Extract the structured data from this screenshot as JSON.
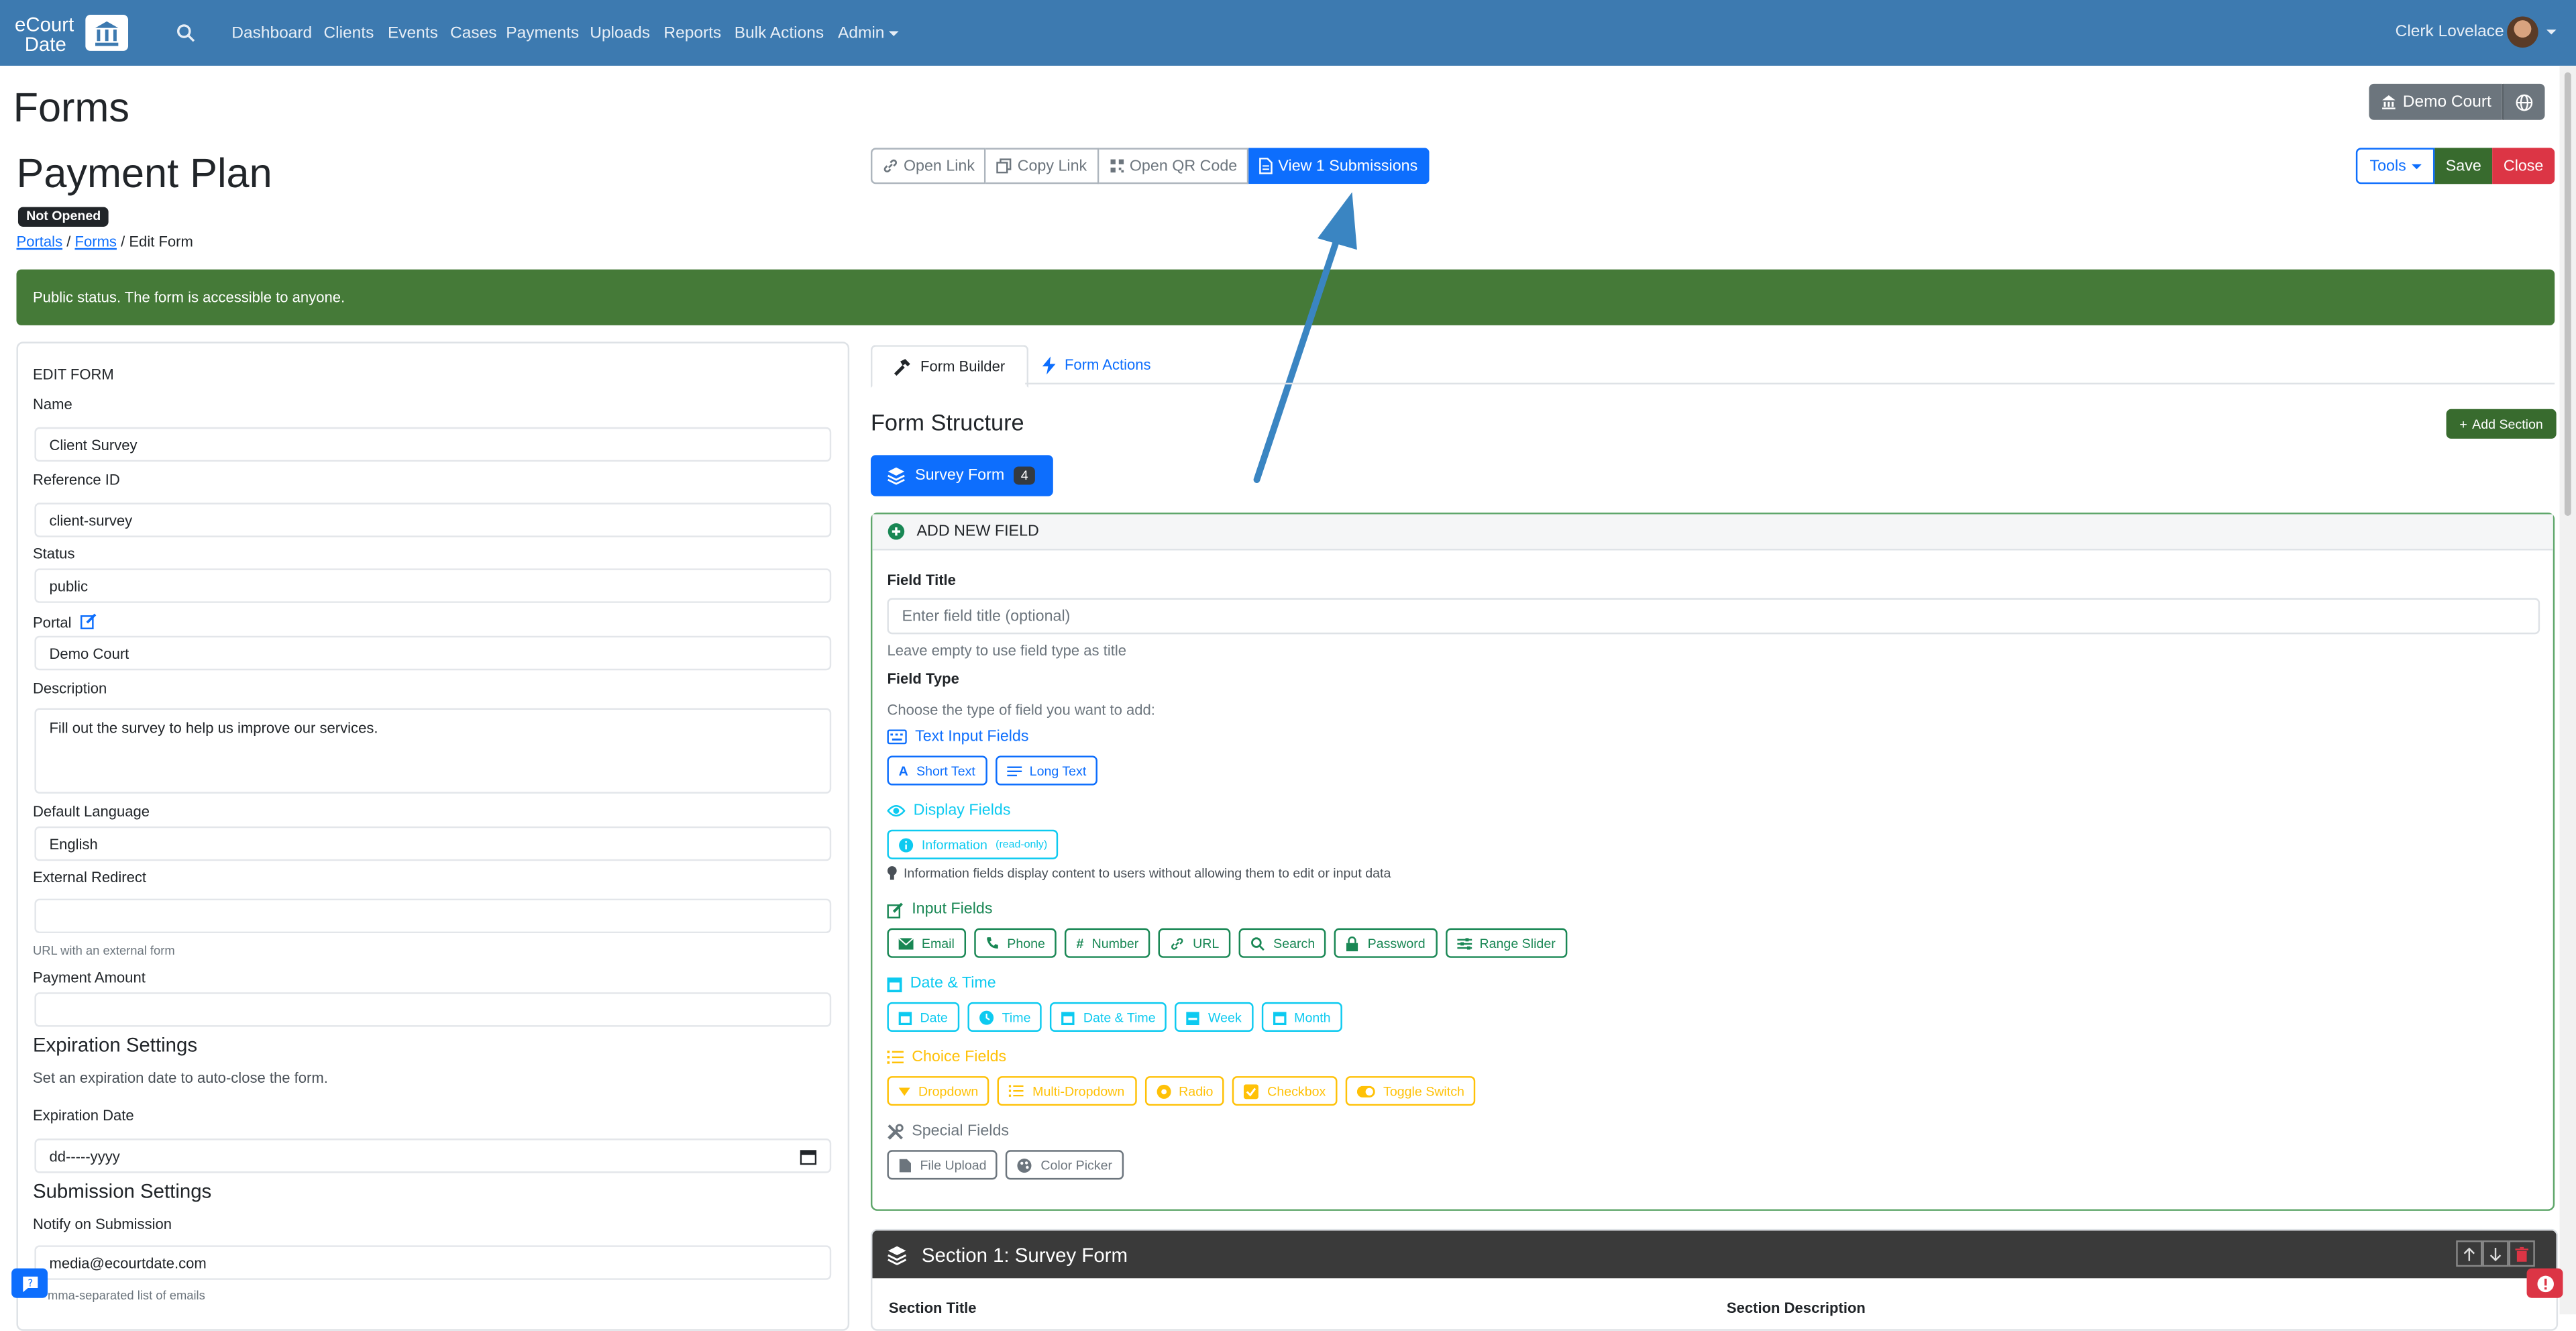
{
  "nav": {
    "brand_line1": "eCourt",
    "brand_line2": "Date",
    "items": [
      "Dashboard",
      "Clients",
      "Events",
      "Cases",
      "Payments",
      "Uploads",
      "Reports",
      "Bulk Actions",
      "Admin"
    ],
    "user": "Clerk Lovelace"
  },
  "page": {
    "title": "Forms",
    "court_button": "Demo Court",
    "form_title": "Payment Plan",
    "status_badge": "Not Opened",
    "breadcrumb": [
      "Portals",
      "Forms",
      "Edit Form"
    ]
  },
  "toolbar": {
    "open_link": "Open Link",
    "copy_link": "Copy Link",
    "open_qr": "Open QR Code",
    "view_submissions": "View 1 Submissions",
    "tools": "Tools",
    "save": "Save",
    "close": "Close"
  },
  "alert": "Public status. The form is accessible to anyone.",
  "edit_form": {
    "heading": "EDIT FORM",
    "name_label": "Name",
    "name_value": "Client Survey",
    "ref_label": "Reference ID",
    "ref_value": "client-survey",
    "status_label": "Status",
    "status_value": "public",
    "portal_label": "Portal",
    "portal_value": "Demo Court",
    "desc_label": "Description",
    "desc_value": "Fill out the survey to help us improve our services.",
    "lang_label": "Default Language",
    "lang_value": "English",
    "redirect_label": "External Redirect",
    "redirect_value": "",
    "redirect_help": "URL with an external form",
    "amount_label": "Payment Amount",
    "amount_value": "",
    "exp_heading": "Expiration Settings",
    "exp_help": "Set an expiration date to auto-close the form.",
    "exp_date_label": "Expiration Date",
    "exp_date_value": "dd-----yyyy",
    "sub_heading": "Submission Settings",
    "notify_label": "Notify on Submission",
    "notify_value": "media@ecourtdate.com",
    "notify_help": "mma-separated list of emails"
  },
  "builder": {
    "tab_builder": "Form Builder",
    "tab_actions": "Form Actions",
    "structure_title": "Form Structure",
    "add_section": "Add Section",
    "survey_form": "Survey Form",
    "survey_count": "4",
    "add_new_field": "ADD NEW FIELD",
    "field_title_label": "Field Title",
    "field_title_placeholder": "Enter field title (optional)",
    "field_title_help": "Leave empty to use field type as title",
    "field_type_label": "Field Type",
    "field_type_help": "Choose the type of field you want to add:",
    "text_input_fields": "Text Input Fields",
    "short_text": "Short Text",
    "long_text": "Long Text",
    "display_fields": "Display Fields",
    "information": "Information",
    "read_only": "(read-only)",
    "display_help": "Information fields display content to users without allowing them to edit or input data",
    "input_fields": "Input Fields",
    "email": "Email",
    "phone": "Phone",
    "number": "Number",
    "url": "URL",
    "search": "Search",
    "password": "Password",
    "range_slider": "Range Slider",
    "date_time_title": "Date & Time",
    "date": "Date",
    "time": "Time",
    "date_time": "Date & Time",
    "week": "Week",
    "month": "Month",
    "choice_fields": "Choice Fields",
    "dropdown": "Dropdown",
    "multi_dropdown": "Multi-Dropdown",
    "radio": "Radio",
    "checkbox": "Checkbox",
    "toggle_switch": "Toggle Switch",
    "special_fields": "Special Fields",
    "file_upload": "File Upload",
    "color_picker": "Color Picker",
    "section1_title": "Section 1: Survey Form",
    "section_title_label": "Section Title",
    "section_desc_label": "Section Description"
  },
  "colors": {
    "navbar": "#3d7ab0",
    "primary": "#0d6efd",
    "success": "#386b2e",
    "danger": "#dc3545",
    "alert_green": "#457a38"
  }
}
